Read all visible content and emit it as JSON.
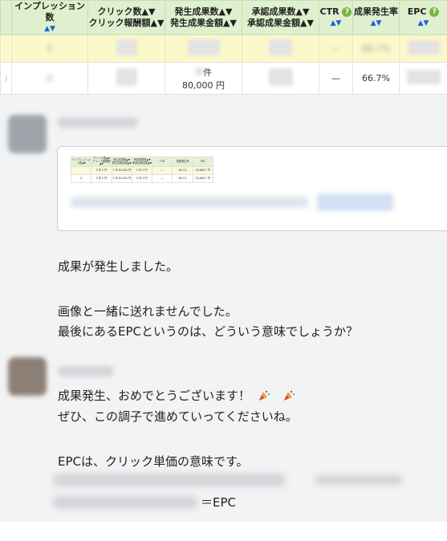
{
  "report": {
    "headers": [
      {
        "name": "col-edge",
        "line1": "",
        "line2": ""
      },
      {
        "name": "col-impressions",
        "line1": "インプレッション数",
        "line2": "▲▼"
      },
      {
        "name": "col-clicks",
        "line1": "クリック数▲▼",
        "line2": "クリック報酬額▲▼"
      },
      {
        "name": "col-conversions",
        "line1": "発生成果数▲▼",
        "line2": "発生成果金額▲▼"
      },
      {
        "name": "col-approved",
        "line1": "承認成果数▲▼",
        "line2": "承認成果金額▲▼"
      },
      {
        "name": "col-ctr",
        "line1": "CTR",
        "line2": "▲▼",
        "help": "?"
      },
      {
        "name": "col-cvr",
        "line1": "成果発生率",
        "line2": "▲▼"
      },
      {
        "name": "col-epc",
        "line1": "EPC",
        "line2": "▲▼",
        "help": "?"
      }
    ],
    "row2": {
      "conversions_count_suffix": "件",
      "conversions_amount": "80,000 円",
      "ctr": "—",
      "cvr": "66.7%",
      "edge": ")"
    }
  },
  "mini_table": {
    "headers": [
      "インプレッション数▲▼",
      "クリック数▲▼ クリック報酬額▲▼",
      "発生成果数▲▼ 発生成果金額▲▼",
      "承認成果数▲▼ 承認成果金額▲▼",
      "CTR",
      "成果発生率",
      "EPC"
    ],
    "row1": [
      "",
      "0 件 0 円",
      "1 件 80,000 円",
      "0 件 0 円",
      "—",
      "66.7%",
      "26,666.7 円"
    ],
    "row2": [
      "0",
      "0 件 0 円",
      "1 件 80,000 円",
      "0 件 0 円",
      "—",
      "66.7%",
      "26,666.7 円"
    ]
  },
  "messages": {
    "m1": "成果が発生しました。",
    "m2": "画像と一緒に送れませんでした。",
    "m3": "最後にあるEPCというのは、どういう意味でしょうか？",
    "m4": "成果発生、おめでとうございます！",
    "m5": "ぜひ、この調子で進めていってくださいね。",
    "m6": "EPCは、クリック単価の意味です。",
    "eq": "＝EPC"
  },
  "emoji": {
    "party": "🎉",
    "colors": {
      "accent": "#1a64d8",
      "help": "#7cb342",
      "header_bg": "#dff0cf",
      "highlight_row": "#fdf8c9",
      "chat_bg": "#f2f3f4"
    }
  }
}
